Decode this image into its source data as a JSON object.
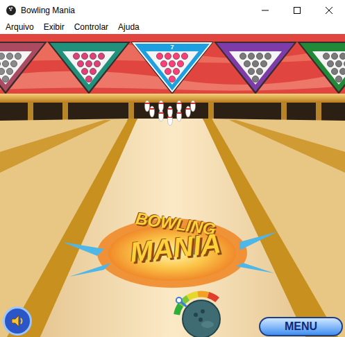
{
  "window": {
    "title": "Bowling Mania"
  },
  "menu": [
    {
      "label": "Arquivo"
    },
    {
      "label": "Exibir"
    },
    {
      "label": "Controlar"
    },
    {
      "label": "Ajuda"
    }
  ],
  "racks": [
    {
      "number": "",
      "color": "#c0506a",
      "pin_color": "#8a8a8a",
      "selected": false
    },
    {
      "number": "",
      "color": "#1fa38a",
      "pin_color": "#e0407a",
      "selected": false
    },
    {
      "number": "7",
      "color": "#1e9fe0",
      "pin_color": "#ff3d7a",
      "selected": true
    },
    {
      "number": "",
      "color": "#8b3fc0",
      "pin_color": "#7a7a7a",
      "selected": false
    },
    {
      "number": "",
      "color": "#1d9a3a",
      "pin_color": "#7a7a7a",
      "selected": false
    }
  ],
  "logo": {
    "line1": "BOWLING",
    "line2": "MANIA"
  },
  "power": {
    "level": 0.25
  },
  "sound": {
    "on": true
  },
  "buttons": {
    "menu": "MENU"
  }
}
